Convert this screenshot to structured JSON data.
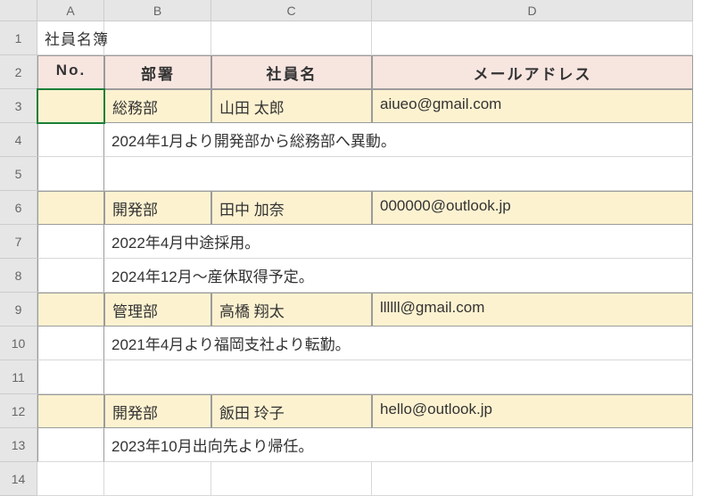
{
  "columns": [
    "A",
    "B",
    "C",
    "D"
  ],
  "rows": [
    "1",
    "2",
    "3",
    "4",
    "5",
    "6",
    "7",
    "8",
    "9",
    "10",
    "11",
    "12",
    "13",
    "14"
  ],
  "title": "社員名簿",
  "headers": {
    "no": "No.",
    "dept": "部署",
    "name": "社員名",
    "email": "メールアドレス"
  },
  "records": [
    {
      "dept": "総務部",
      "name": "山田 太郎",
      "email": "aiueo@gmail.com",
      "notes": [
        "2024年1月より開発部から総務部へ異動。",
        ""
      ]
    },
    {
      "dept": "開発部",
      "name": "田中 加奈",
      "email": "000000@outlook.jp",
      "notes": [
        "2022年4月中途採用。",
        "2024年12月～産休取得予定。"
      ]
    },
    {
      "dept": "管理部",
      "name": "高橋 翔太",
      "email": "llllll@gmail.com",
      "notes": [
        "2021年4月より福岡支社より転勤。",
        ""
      ]
    },
    {
      "dept": "開発部",
      "name": "飯田 玲子",
      "email": "hello@outlook.jp",
      "notes": [
        "2023年10月出向先より帰任。"
      ]
    }
  ],
  "chart_data": {
    "type": "table",
    "title": "社員名簿",
    "columns": [
      "No.",
      "部署",
      "社員名",
      "メールアドレス"
    ],
    "rows": [
      [
        "",
        "総務部",
        "山田 太郎",
        "aiueo@gmail.com"
      ],
      [
        "",
        "開発部",
        "田中 加奈",
        "000000@outlook.jp"
      ],
      [
        "",
        "管理部",
        "高橋 翔太",
        "llllll@gmail.com"
      ],
      [
        "",
        "開発部",
        "飯田 玲子",
        "hello@outlook.jp"
      ]
    ]
  }
}
